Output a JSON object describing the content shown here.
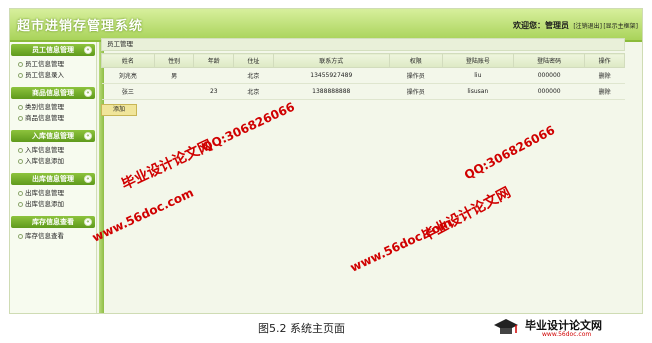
{
  "app": {
    "title": "超市进销存管理系统"
  },
  "header": {
    "welcome": "欢迎您：管理员",
    "logout_link": "[注销退出]",
    "home_link": "[显示主框架]"
  },
  "sidebar": {
    "sections": [
      {
        "title": "员工信息管理",
        "items": [
          "员工信息管理",
          "员工信息录入"
        ]
      },
      {
        "title": "商品信息管理",
        "items": [
          "类别信息管理",
          "商品信息管理"
        ]
      },
      {
        "title": "入库信息管理",
        "items": [
          "入库信息管理",
          "入库信息添加"
        ]
      },
      {
        "title": "出库信息管理",
        "items": [
          "出库信息管理",
          "出库信息添加"
        ]
      },
      {
        "title": "库存信息查看",
        "items": [
          "库存信息查看"
        ]
      }
    ],
    "toggle_glyph": "«"
  },
  "main": {
    "panel_title": "员工管理",
    "columns": [
      "姓名",
      "性别",
      "年龄",
      "住址",
      "联系方式",
      "权限",
      "登陆账号",
      "登陆密码",
      "操作"
    ],
    "rows": [
      [
        "刘兆亮",
        "男",
        "",
        "北京",
        "13455927489",
        "操作员",
        "liu",
        "000000",
        "删除"
      ],
      [
        "张三",
        "",
        "23",
        "北京",
        "1388888888",
        "操作员",
        "lisusan",
        "000000",
        "删除"
      ]
    ],
    "add_button": "添加"
  },
  "watermarks": {
    "brand": "毕业设计论文网",
    "qq": "QQ:306826066",
    "url": "www.56doc.com"
  },
  "caption": "图5.2 系统主页面",
  "footer_logo": {
    "text": "毕业设计论文网",
    "url": "www.56doc.com"
  }
}
